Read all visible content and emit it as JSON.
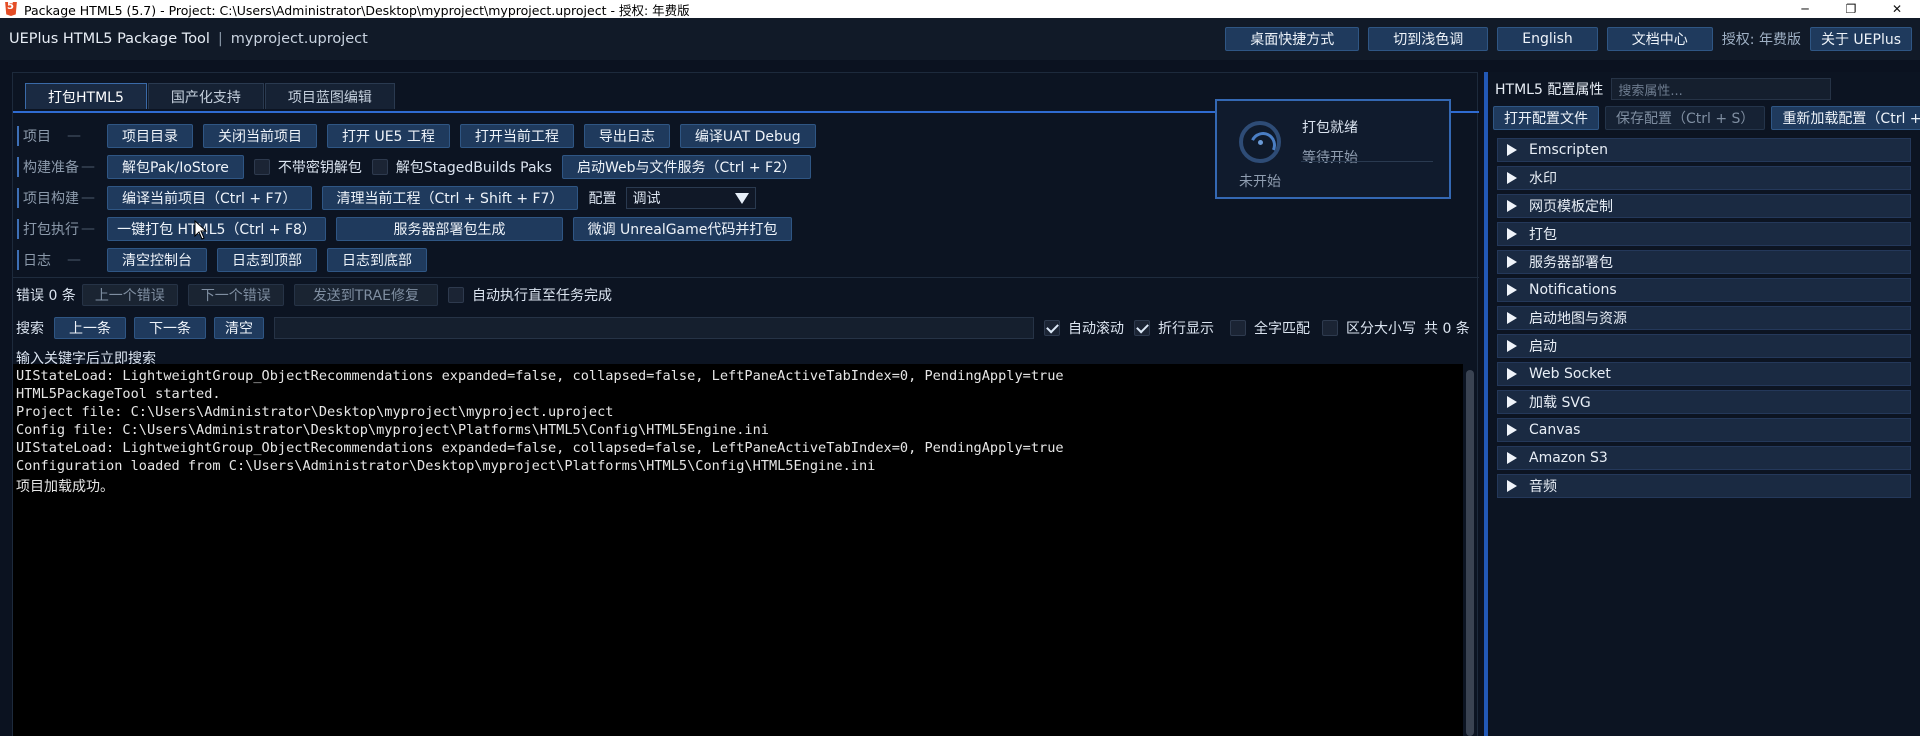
{
  "window": {
    "title": "Package HTML5 (5.7) - Project: C:\\Users\\Administrator\\Desktop\\myproject\\myproject.uproject - 授权: 年费版",
    "minimize": "─",
    "restore": "❐",
    "close": "✕"
  },
  "header": {
    "app_name": "UEPlus HTML5 Package Tool",
    "separator": "|",
    "project_name": "myproject.uproject",
    "buttons": [
      "桌面快捷方式",
      "切到浅色调",
      "English",
      "文档中心"
    ],
    "license": "授权: 年费版",
    "about": "关于 UEPlus"
  },
  "tabs": [
    "打包HTML5",
    "国产化支持",
    "项目蓝图编辑"
  ],
  "rows": {
    "project": {
      "label": "项目",
      "dash": "—",
      "buttons": [
        "项目目录",
        "关闭当前项目",
        "打开 UE5 工程",
        "打开当前工程",
        "导出日志",
        "编译UAT Debug"
      ]
    },
    "prep": {
      "label": "构建准备",
      "dash": "—",
      "unpak": "解包Pak/IoStore",
      "no_key": "不带密钥解包",
      "unpak_staged": "解包StagedBuilds Paks",
      "web_service": "启动Web与文件服务（Ctrl + F2）"
    },
    "build": {
      "label": "项目构建",
      "dash": "—",
      "compile": "编译当前项目（Ctrl + F7）",
      "clean": "清理当前工程（Ctrl + Shift + F7）",
      "config_label": "配置",
      "config_value": "调试"
    },
    "package": {
      "label": "打包执行",
      "dash": "—",
      "one_click": "一键打包 HTML5（Ctrl + F8）",
      "server_deploy": "服务器部署包生成",
      "microcode": "微调 UnrealGame代码并打包"
    },
    "log": {
      "label": "日志",
      "dash": "—",
      "buttons": [
        "清空控制台",
        "日志到顶部",
        "日志到底部"
      ]
    }
  },
  "status": {
    "title": "打包就绪",
    "subtitle": "等待开始",
    "state": "未开始"
  },
  "errors": {
    "label": "错误 0 条",
    "prev": "上一个错误",
    "next": "下一个错误",
    "send": "发送到TRAE修复",
    "auto_exec": "自动执行直至任务完成"
  },
  "search": {
    "label": "搜索",
    "prev": "上一条",
    "next": "下一条",
    "clear": "清空",
    "value": "",
    "auto_scroll": "自动滚动",
    "auto_scroll_checked": true,
    "wrap": "折行显示",
    "wrap_checked": true,
    "whole_word": "全字匹配",
    "case": "区分大小写",
    "count": "共 0 条",
    "hint": "输入关键字后立即搜索"
  },
  "console": {
    "lines": [
      "UIStateLoad: LightweightGroup_ObjectRecommendations expanded=false, collapsed=false, LeftPaneActiveTabIndex=0, PendingApply=true",
      "HTML5PackageTool started.",
      "Project file: C:\\Users\\Administrator\\Desktop\\myproject\\myproject.uproject",
      "Config file: C:\\Users\\Administrator\\Desktop\\myproject\\Platforms\\HTML5\\Config\\HTML5Engine.ini",
      "UIStateLoad: LightweightGroup_ObjectRecommendations expanded=false, collapsed=false, LeftPaneActiveTabIndex=0, PendingApply=true",
      "Configuration loaded from C:\\Users\\Administrator\\Desktop\\myproject\\Platforms\\HTML5\\Config\\HTML5Engine.ini"
    ],
    "success": "项目加载成功。"
  },
  "right": {
    "title": "HTML5 配置属性",
    "search_placeholder": "搜索属性...",
    "open_config": "打开配置文件",
    "save_config": "保存配置（Ctrl + S）",
    "reload_config": "重新加载配置（Ctrl +",
    "sections": [
      "Emscripten",
      "水印",
      "网页模板定制",
      "打包",
      "服务器部署包",
      "Notifications",
      "启动地图与资源",
      "启动",
      "Web Socket",
      "加载 SVG",
      "Canvas",
      "Amazon S3",
      "音频"
    ]
  },
  "colors": {
    "accent": "#2f6bd1",
    "button": "#1f3a5d",
    "background": "#0c1422",
    "console": "#000000"
  }
}
